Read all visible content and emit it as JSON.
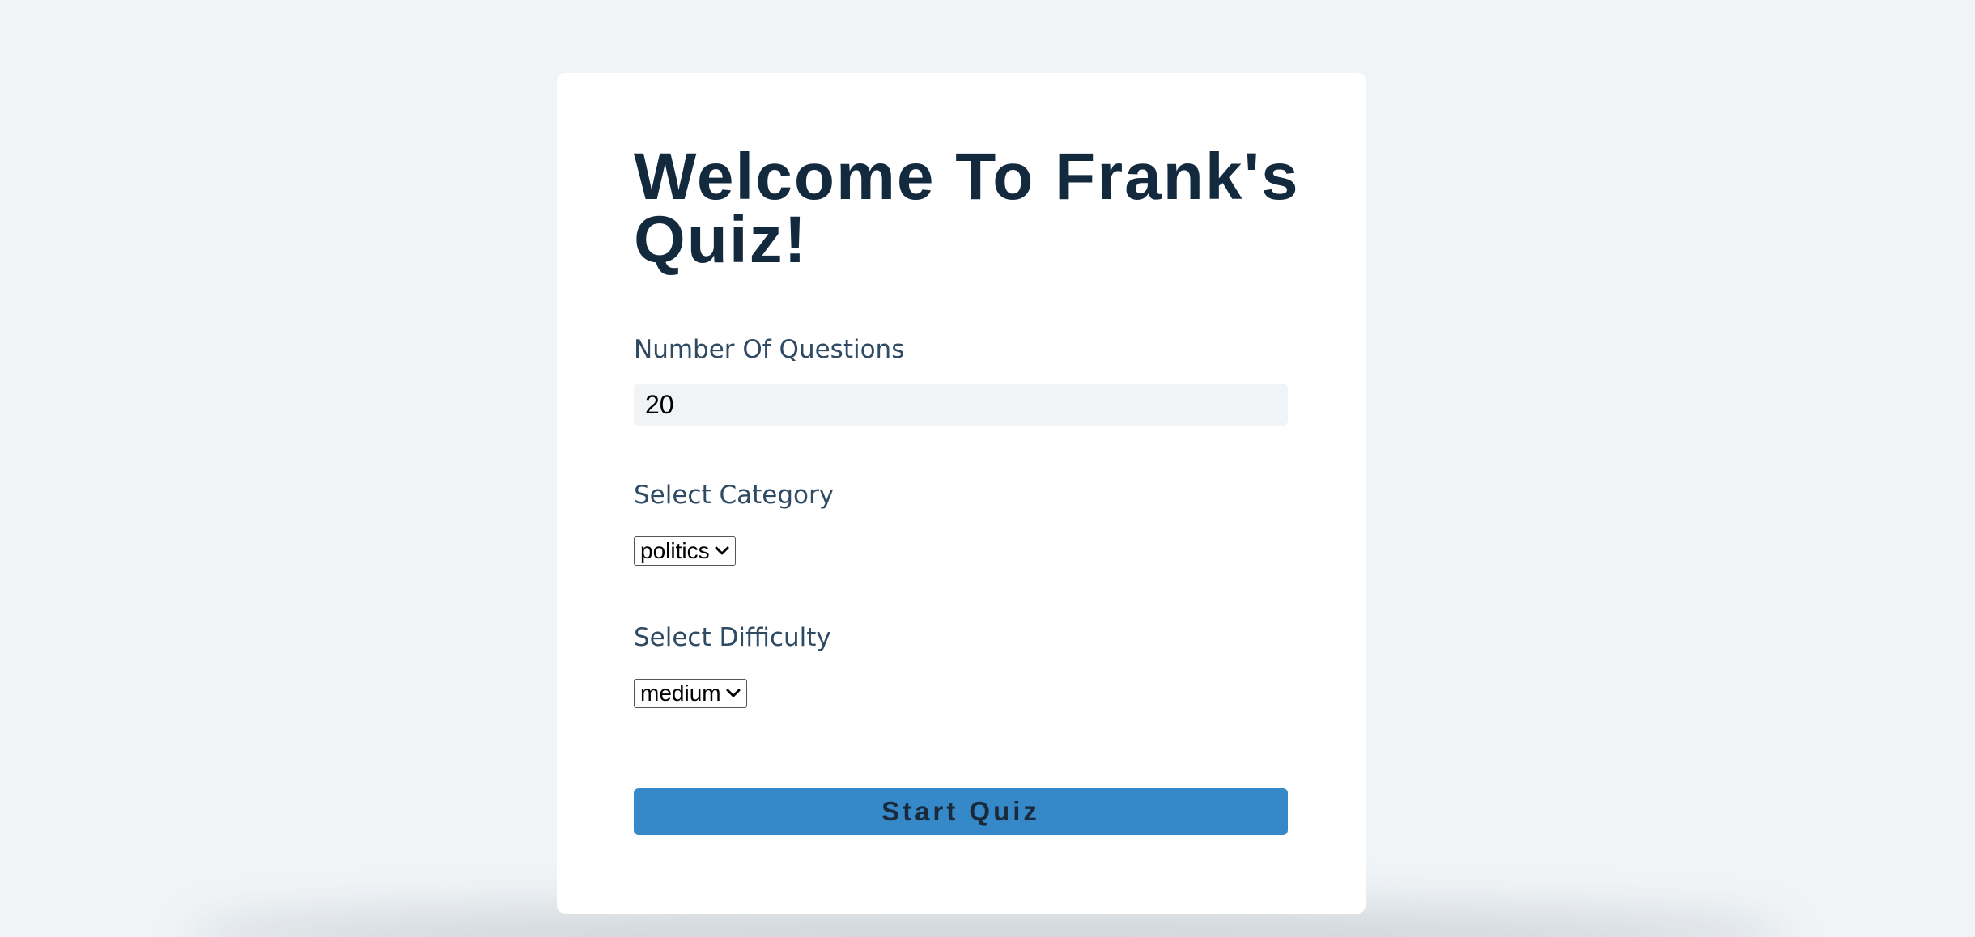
{
  "header": {
    "title": "Welcome To Frank's Quiz!"
  },
  "form": {
    "questions_label": "Number Of Questions",
    "questions_value": "20",
    "category_label": "Select Category",
    "category_selected": "politics",
    "difficulty_label": "Select Difficulty",
    "difficulty_selected": "medium",
    "start_label": "Start Quiz"
  },
  "icons": {
    "dropdown": "chevron-down-icon"
  },
  "colors": {
    "background": "#f0f4f7",
    "card": "#ffffff",
    "title": "#13293d",
    "label": "#2f4a63",
    "button": "#3589c8",
    "button_text": "#1b2a3a"
  }
}
